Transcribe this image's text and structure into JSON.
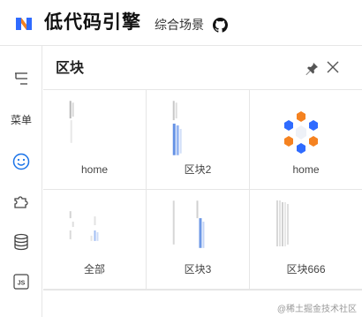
{
  "header": {
    "app_title": "低代码引擎",
    "scene_link": "综合场景",
    "logo_icon": "lowcode-logo-icon",
    "github_icon": "github-icon"
  },
  "sidebar": {
    "items": [
      {
        "icon": "outline-tree-icon"
      },
      {
        "label": "菜单"
      },
      {
        "icon": "smile-icon",
        "active": true
      },
      {
        "icon": "puzzle-icon"
      },
      {
        "icon": "database-icon"
      },
      {
        "icon": "js-icon",
        "icon_text": "JS"
      }
    ]
  },
  "panel": {
    "title": "区块",
    "pin_icon": "pin-icon",
    "close_icon": "close-icon"
  },
  "blocks": [
    {
      "label": "home",
      "thumb": "blurred-preview"
    },
    {
      "label": "区块2",
      "thumb": "blurred-preview-blue"
    },
    {
      "label": "home",
      "thumb": "hexagon-logo"
    },
    {
      "label": "全部",
      "thumb": "blurred-preview-small"
    },
    {
      "label": "区块3",
      "thumb": "blurred-preview-blue"
    },
    {
      "label": "区块666",
      "thumb": "blurred-preview-stripes"
    }
  ],
  "watermark": "@稀土掘金技术社区",
  "colors": {
    "accent_blue": "#1a73e8",
    "logo_orange": "#f58220",
    "logo_blue": "#2f6bff",
    "border": "#e6e6e6"
  }
}
